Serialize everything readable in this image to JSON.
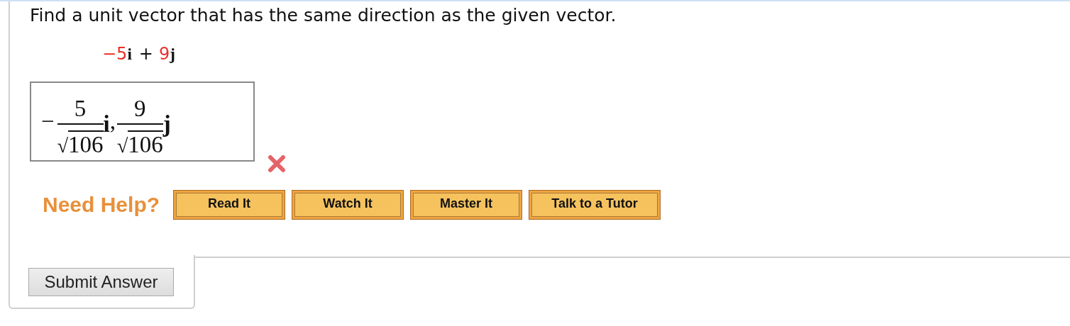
{
  "question": {
    "prompt": "Find a unit vector that has the same direction as the given vector.",
    "vector": {
      "terms": [
        {
          "coefficient": "−5",
          "unit": "i"
        },
        {
          "coefficient": "9",
          "unit": "j"
        }
      ],
      "joiner": "+"
    }
  },
  "answer": {
    "correct": false,
    "parts": [
      {
        "sign": "−",
        "numerator": "5",
        "radical": "√",
        "radicand": "106",
        "unit": "i",
        "separator": ","
      },
      {
        "numerator": "9",
        "radical": "√",
        "radicand": "106",
        "unit": "j"
      }
    ]
  },
  "help": {
    "label": "Need Help?",
    "buttons": [
      "Read It",
      "Watch It",
      "Master It",
      "Talk to a Tutor"
    ]
  },
  "submit": {
    "label": "Submit Answer"
  }
}
